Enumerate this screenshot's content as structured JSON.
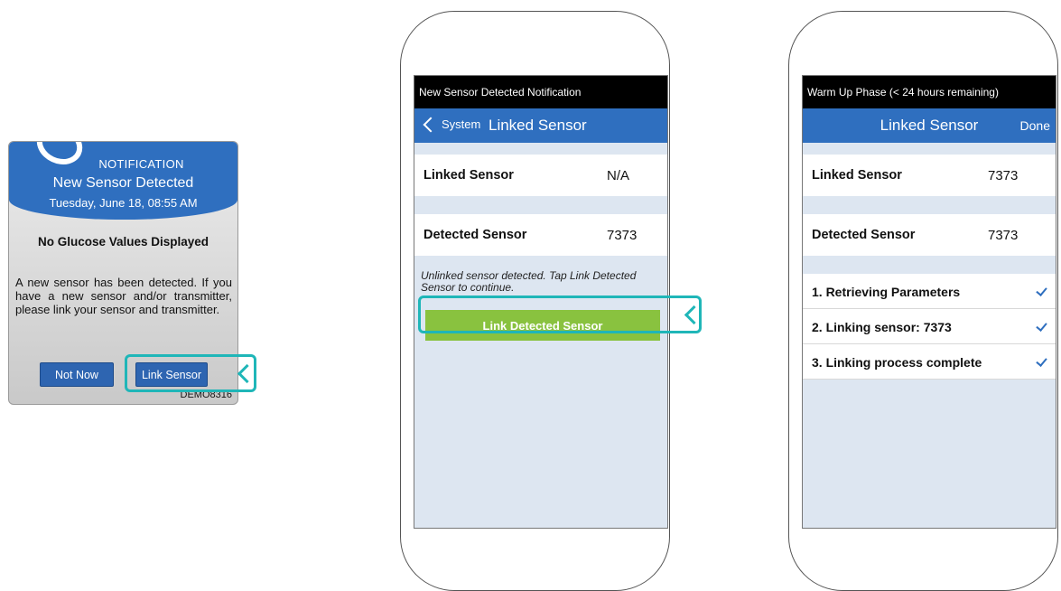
{
  "pump": {
    "notification_label": "NOTIFICATION",
    "title": "New Sensor Detected",
    "datetime": "Tuesday, June 18, 08:55 AM",
    "status": "No Glucose Values Displayed",
    "message": "A new sensor has been detected. If you have a new sensor and/or transmitter, please link your sensor and transmitter.",
    "not_now_label": "Not Now",
    "link_label": "Link Sensor",
    "device_id": "DEMO8316"
  },
  "phone2": {
    "status_bar": "New Sensor Detected Notification",
    "back_label": "System",
    "title": "Linked Sensor",
    "linked_label": "Linked Sensor",
    "linked_value": "N/A",
    "detected_label": "Detected Sensor",
    "detected_value": "7373",
    "note": "Unlinked sensor detected. Tap Link Detected Sensor to continue.",
    "button_label": "Link Detected Sensor"
  },
  "phone3": {
    "status_bar": "Warm Up Phase (< 24 hours remaining)",
    "title": "Linked Sensor",
    "done_label": "Done",
    "linked_label": "Linked Sensor",
    "linked_value": "7373",
    "detected_label": "Detected Sensor",
    "detected_value": "7373",
    "steps": [
      {
        "label": "1. Retrieving Parameters"
      },
      {
        "label": "2. Linking sensor: 7373"
      },
      {
        "label": "3. Linking process complete"
      }
    ]
  },
  "colors": {
    "brand_blue": "#2f6fbf",
    "highlight_teal": "#1fb6b8",
    "action_green": "#89c23f"
  }
}
